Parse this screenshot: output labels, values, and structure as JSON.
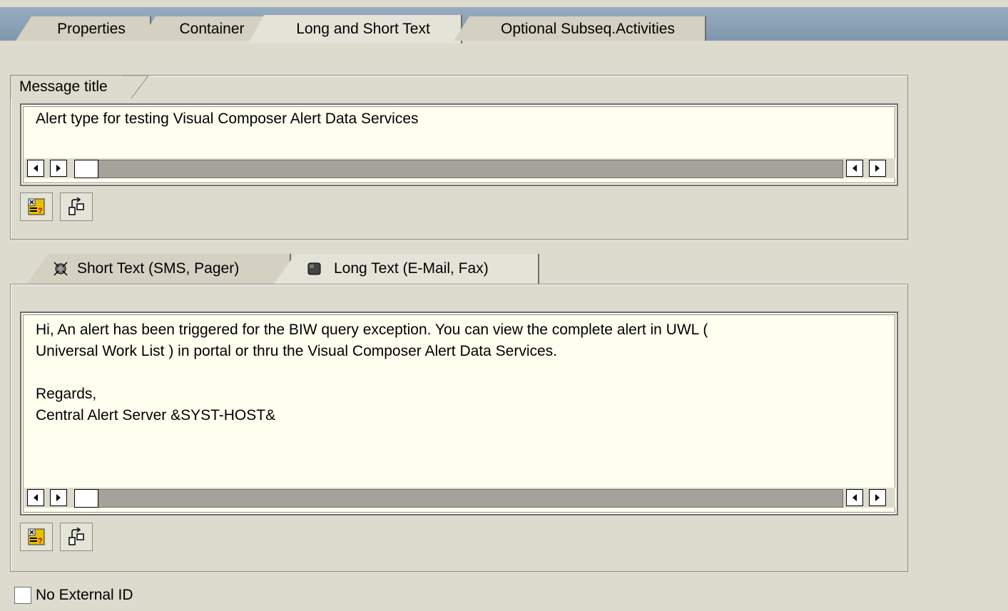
{
  "tabs": [
    {
      "label": "Properties",
      "active": false
    },
    {
      "label": "Container",
      "active": false
    },
    {
      "label": "Long and Short Text",
      "active": true
    },
    {
      "label": "Optional Subseq.Activities",
      "active": false
    }
  ],
  "message_title": {
    "group_label": "Message title",
    "text": "Alert type for testing Visual Composer Alert Data Services"
  },
  "text_tabs": [
    {
      "label": "Short Text (SMS, Pager)",
      "icon": "pager-icon",
      "active": false
    },
    {
      "label": "Long Text (E-Mail, Fax)",
      "icon": "email-icon",
      "active": true
    }
  ],
  "long_text": {
    "lines": [
      "Hi, An alert has been triggered for the BIW query exception. You can view the complete alert in UWL (",
      "Universal Work List ) in portal or thru the Visual Composer Alert Data Services.",
      "",
      "Regards,",
      "Central Alert Server &SYST-HOST&"
    ]
  },
  "toolbar_icons": [
    "insert-variable-icon",
    "container-element-icon"
  ],
  "no_external_id": {
    "label": "No External ID",
    "checked": false
  }
}
